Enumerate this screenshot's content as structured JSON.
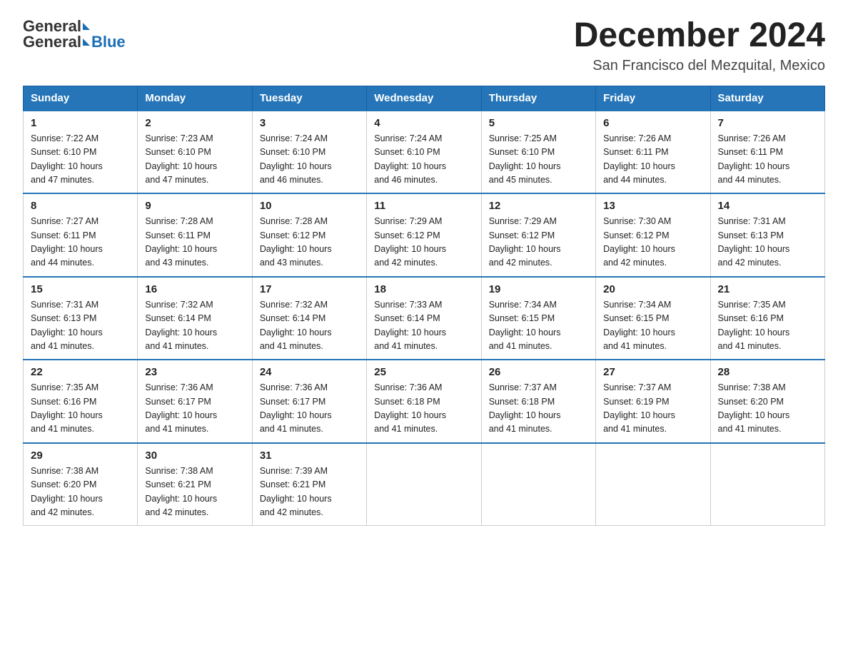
{
  "header": {
    "logo_general": "General",
    "logo_blue": "Blue",
    "month_title": "December 2024",
    "location": "San Francisco del Mezquital, Mexico"
  },
  "days_of_week": [
    "Sunday",
    "Monday",
    "Tuesday",
    "Wednesday",
    "Thursday",
    "Friday",
    "Saturday"
  ],
  "weeks": [
    [
      {
        "day": "1",
        "sunrise": "7:22 AM",
        "sunset": "6:10 PM",
        "daylight": "10 hours and 47 minutes."
      },
      {
        "day": "2",
        "sunrise": "7:23 AM",
        "sunset": "6:10 PM",
        "daylight": "10 hours and 47 minutes."
      },
      {
        "day": "3",
        "sunrise": "7:24 AM",
        "sunset": "6:10 PM",
        "daylight": "10 hours and 46 minutes."
      },
      {
        "day": "4",
        "sunrise": "7:24 AM",
        "sunset": "6:10 PM",
        "daylight": "10 hours and 46 minutes."
      },
      {
        "day": "5",
        "sunrise": "7:25 AM",
        "sunset": "6:10 PM",
        "daylight": "10 hours and 45 minutes."
      },
      {
        "day": "6",
        "sunrise": "7:26 AM",
        "sunset": "6:11 PM",
        "daylight": "10 hours and 44 minutes."
      },
      {
        "day": "7",
        "sunrise": "7:26 AM",
        "sunset": "6:11 PM",
        "daylight": "10 hours and 44 minutes."
      }
    ],
    [
      {
        "day": "8",
        "sunrise": "7:27 AM",
        "sunset": "6:11 PM",
        "daylight": "10 hours and 44 minutes."
      },
      {
        "day": "9",
        "sunrise": "7:28 AM",
        "sunset": "6:11 PM",
        "daylight": "10 hours and 43 minutes."
      },
      {
        "day": "10",
        "sunrise": "7:28 AM",
        "sunset": "6:12 PM",
        "daylight": "10 hours and 43 minutes."
      },
      {
        "day": "11",
        "sunrise": "7:29 AM",
        "sunset": "6:12 PM",
        "daylight": "10 hours and 42 minutes."
      },
      {
        "day": "12",
        "sunrise": "7:29 AM",
        "sunset": "6:12 PM",
        "daylight": "10 hours and 42 minutes."
      },
      {
        "day": "13",
        "sunrise": "7:30 AM",
        "sunset": "6:12 PM",
        "daylight": "10 hours and 42 minutes."
      },
      {
        "day": "14",
        "sunrise": "7:31 AM",
        "sunset": "6:13 PM",
        "daylight": "10 hours and 42 minutes."
      }
    ],
    [
      {
        "day": "15",
        "sunrise": "7:31 AM",
        "sunset": "6:13 PM",
        "daylight": "10 hours and 41 minutes."
      },
      {
        "day": "16",
        "sunrise": "7:32 AM",
        "sunset": "6:14 PM",
        "daylight": "10 hours and 41 minutes."
      },
      {
        "day": "17",
        "sunrise": "7:32 AM",
        "sunset": "6:14 PM",
        "daylight": "10 hours and 41 minutes."
      },
      {
        "day": "18",
        "sunrise": "7:33 AM",
        "sunset": "6:14 PM",
        "daylight": "10 hours and 41 minutes."
      },
      {
        "day": "19",
        "sunrise": "7:34 AM",
        "sunset": "6:15 PM",
        "daylight": "10 hours and 41 minutes."
      },
      {
        "day": "20",
        "sunrise": "7:34 AM",
        "sunset": "6:15 PM",
        "daylight": "10 hours and 41 minutes."
      },
      {
        "day": "21",
        "sunrise": "7:35 AM",
        "sunset": "6:16 PM",
        "daylight": "10 hours and 41 minutes."
      }
    ],
    [
      {
        "day": "22",
        "sunrise": "7:35 AM",
        "sunset": "6:16 PM",
        "daylight": "10 hours and 41 minutes."
      },
      {
        "day": "23",
        "sunrise": "7:36 AM",
        "sunset": "6:17 PM",
        "daylight": "10 hours and 41 minutes."
      },
      {
        "day": "24",
        "sunrise": "7:36 AM",
        "sunset": "6:17 PM",
        "daylight": "10 hours and 41 minutes."
      },
      {
        "day": "25",
        "sunrise": "7:36 AM",
        "sunset": "6:18 PM",
        "daylight": "10 hours and 41 minutes."
      },
      {
        "day": "26",
        "sunrise": "7:37 AM",
        "sunset": "6:18 PM",
        "daylight": "10 hours and 41 minutes."
      },
      {
        "day": "27",
        "sunrise": "7:37 AM",
        "sunset": "6:19 PM",
        "daylight": "10 hours and 41 minutes."
      },
      {
        "day": "28",
        "sunrise": "7:38 AM",
        "sunset": "6:20 PM",
        "daylight": "10 hours and 41 minutes."
      }
    ],
    [
      {
        "day": "29",
        "sunrise": "7:38 AM",
        "sunset": "6:20 PM",
        "daylight": "10 hours and 42 minutes."
      },
      {
        "day": "30",
        "sunrise": "7:38 AM",
        "sunset": "6:21 PM",
        "daylight": "10 hours and 42 minutes."
      },
      {
        "day": "31",
        "sunrise": "7:39 AM",
        "sunset": "6:21 PM",
        "daylight": "10 hours and 42 minutes."
      },
      null,
      null,
      null,
      null
    ]
  ],
  "labels": {
    "sunrise": "Sunrise:",
    "sunset": "Sunset:",
    "daylight": "Daylight:"
  }
}
